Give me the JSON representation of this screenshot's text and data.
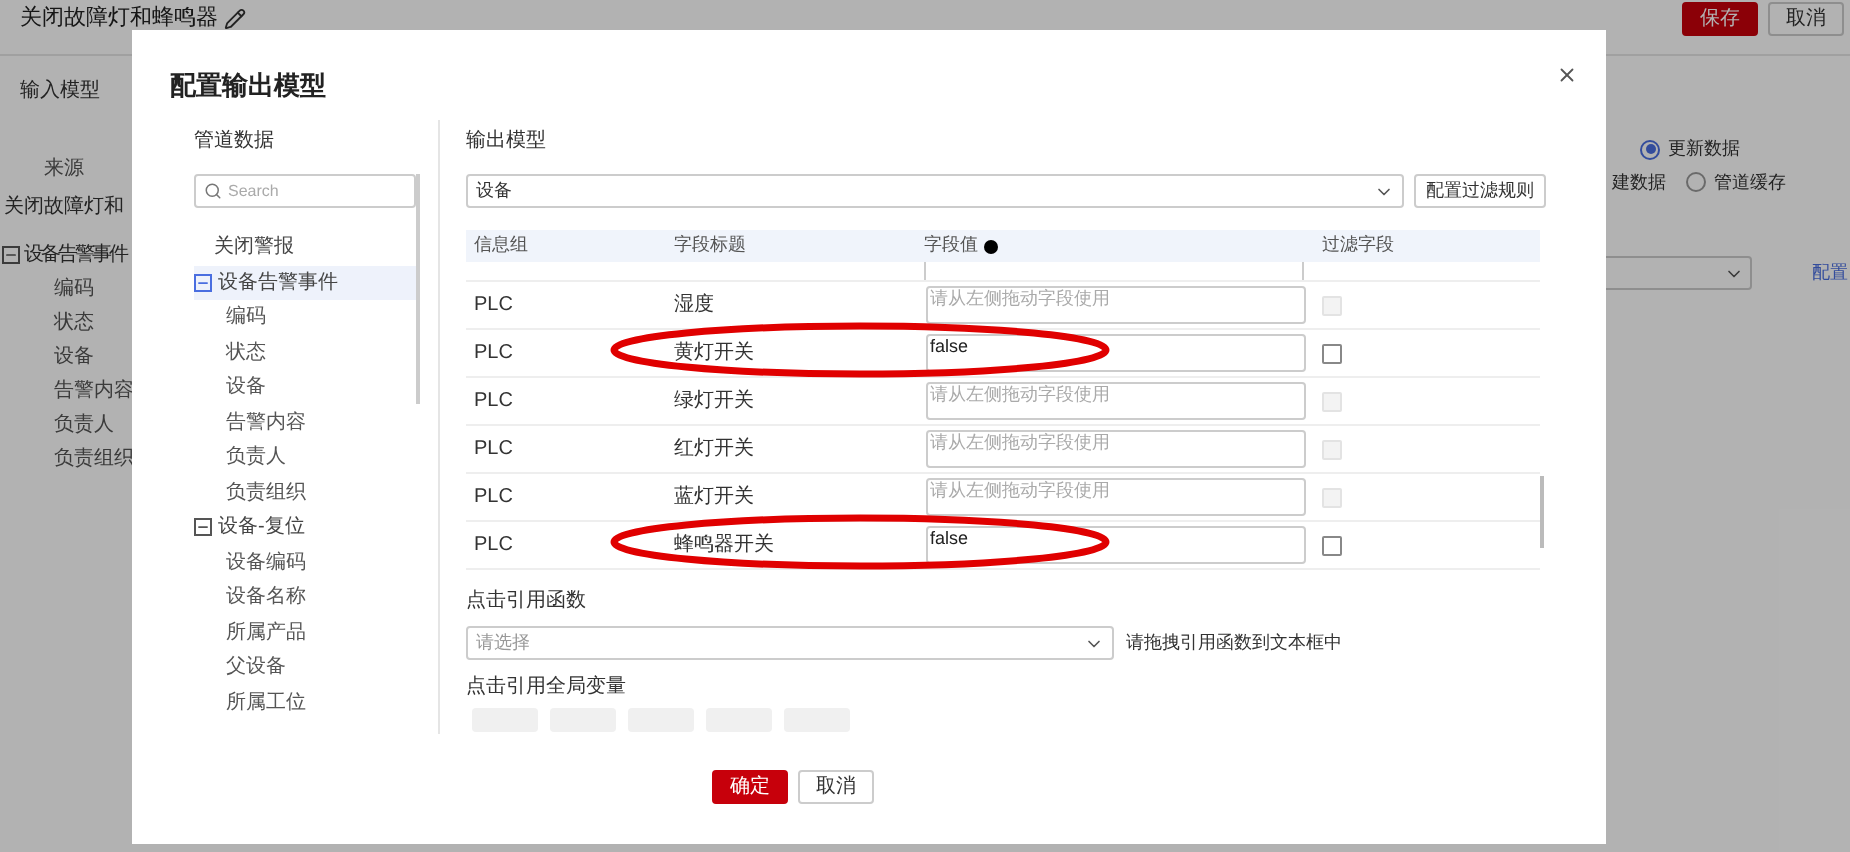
{
  "page": {
    "title": "关闭故障灯和蜂鸣器",
    "buttons": [
      {
        "label": "保存",
        "kind": "primary"
      },
      {
        "label": "取消",
        "kind": "default"
      }
    ],
    "input_model": {
      "heading": "输入模型",
      "source_label": "来源",
      "source_value": "关闭故障灯和",
      "tree": [
        {
          "label": "设备告警事件",
          "expanded": true,
          "children": [
            {
              "label": "编码"
            },
            {
              "label": "状态"
            },
            {
              "label": "设备"
            },
            {
              "label": "告警内容"
            },
            {
              "label": "负责人"
            },
            {
              "label": "负责组织"
            }
          ]
        }
      ]
    },
    "mode_options": [
      {
        "label": "更新数据",
        "selected": true
      },
      {
        "label": "管道缓存",
        "selected": false
      }
    ],
    "cut_label": "建数据",
    "link": "配置"
  },
  "dialog": {
    "title": "配置输出模型",
    "pipeline": {
      "heading": "管道数据",
      "search": {
        "placeholder": "Search"
      },
      "tree": [
        {
          "label": "关闭警报",
          "selected": false
        },
        {
          "label": "设备告警事件",
          "selected": true,
          "expanded": true,
          "children": [
            {
              "label": "编码"
            },
            {
              "label": "状态"
            },
            {
              "label": "设备"
            },
            {
              "label": "告警内容"
            },
            {
              "label": "负责人"
            },
            {
              "label": "负责组织"
            }
          ]
        },
        {
          "label": "设备-复位",
          "selected": false,
          "expanded": true,
          "children": [
            {
              "label": "设备编码"
            },
            {
              "label": "设备名称"
            },
            {
              "label": "所属产品"
            },
            {
              "label": "父设备"
            },
            {
              "label": "所属工位"
            }
          ]
        }
      ]
    },
    "output": {
      "heading": "输出模型",
      "model_select": {
        "value": "设备"
      },
      "filter_button": "配置过滤规则",
      "table": {
        "columns": [
          "信息组",
          "字段标题",
          "字段值",
          "过滤字段"
        ],
        "rows": [
          {
            "group": "PLC",
            "title": "湿度",
            "placeholder": "请从左侧拖动字段使用",
            "filter": {
              "checked": false,
              "disabled": true
            },
            "circled": false
          },
          {
            "group": "PLC",
            "title": "黄灯开关",
            "value": "false",
            "filter": {
              "checked": false,
              "disabled": false
            },
            "circled": true
          },
          {
            "group": "PLC",
            "title": "绿灯开关",
            "placeholder": "请从左侧拖动字段使用",
            "filter": {
              "checked": false,
              "disabled": true
            },
            "circled": false
          },
          {
            "group": "PLC",
            "title": "红灯开关",
            "placeholder": "请从左侧拖动字段使用",
            "filter": {
              "checked": false,
              "disabled": true
            },
            "circled": false
          },
          {
            "group": "PLC",
            "title": "蓝灯开关",
            "placeholder": "请从左侧拖动字段使用",
            "filter": {
              "checked": false,
              "disabled": true
            },
            "circled": false
          },
          {
            "group": "PLC",
            "title": "蜂鸣器开关",
            "value": "false",
            "filter": {
              "checked": false,
              "disabled": false
            },
            "circled": true
          }
        ]
      },
      "functions": {
        "label": "点击引用函数",
        "select": {
          "placeholder": "请选择"
        },
        "hint": "请拖拽引用函数到文本框中"
      },
      "globals": {
        "label": "点击引用全局变量"
      }
    },
    "footer": [
      {
        "label": "确定",
        "kind": "primary"
      },
      {
        "label": "取消",
        "kind": "default"
      }
    ]
  }
}
